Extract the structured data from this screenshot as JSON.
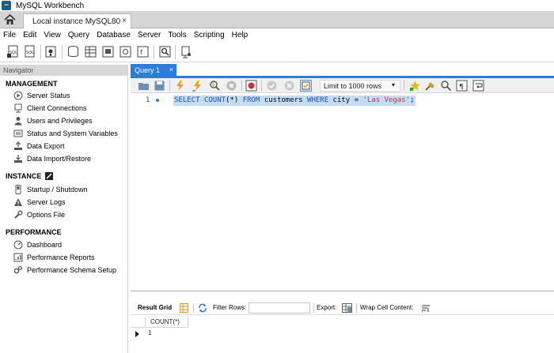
{
  "window": {
    "title": "MySQL Workbench"
  },
  "connection_tab": {
    "label": "Local instance MySQL80",
    "close": "×"
  },
  "menu": [
    "File",
    "Edit",
    "View",
    "Query",
    "Database",
    "Server",
    "Tools",
    "Scripting",
    "Help"
  ],
  "navigator": {
    "header": "Navigator",
    "management": {
      "title": "MANAGEMENT",
      "items": [
        "Server Status",
        "Client Connections",
        "Users and Privileges",
        "Status and System Variables",
        "Data Export",
        "Data Import/Restore"
      ]
    },
    "instance": {
      "title": "INSTANCE",
      "items": [
        "Startup / Shutdown",
        "Server Logs",
        "Options File"
      ]
    },
    "performance": {
      "title": "PERFORMANCE",
      "items": [
        "Dashboard",
        "Performance Reports",
        "Performance Schema Setup"
      ]
    }
  },
  "query_tab": {
    "label": "Query 1",
    "close": "×"
  },
  "editor_toolbar": {
    "limit_select": "Limit to 1000 rows"
  },
  "editor": {
    "line_number": "1",
    "sql": {
      "select": "SELECT",
      "count": "COUNT",
      "count_args": "(*)",
      "from": "FROM",
      "table": "customers",
      "where": "WHERE",
      "column": "city",
      "equals": "=",
      "value": "'Las Vegas'",
      "semicolon": ";"
    }
  },
  "result_toolbar": {
    "result_grid": "Result Grid",
    "filter_rows": "Filter Rows:",
    "export": "Export:",
    "wrap_cell": "Wrap Cell Content:"
  },
  "result_grid": {
    "columns": [
      "COUNT(*)"
    ],
    "rows": [
      [
        "1"
      ]
    ]
  },
  "colors": {
    "accent_blue": "#2e7cd6",
    "selection": "#c5dcf3",
    "keyword": "#1f4fb4",
    "string": "#bb3b3b"
  }
}
